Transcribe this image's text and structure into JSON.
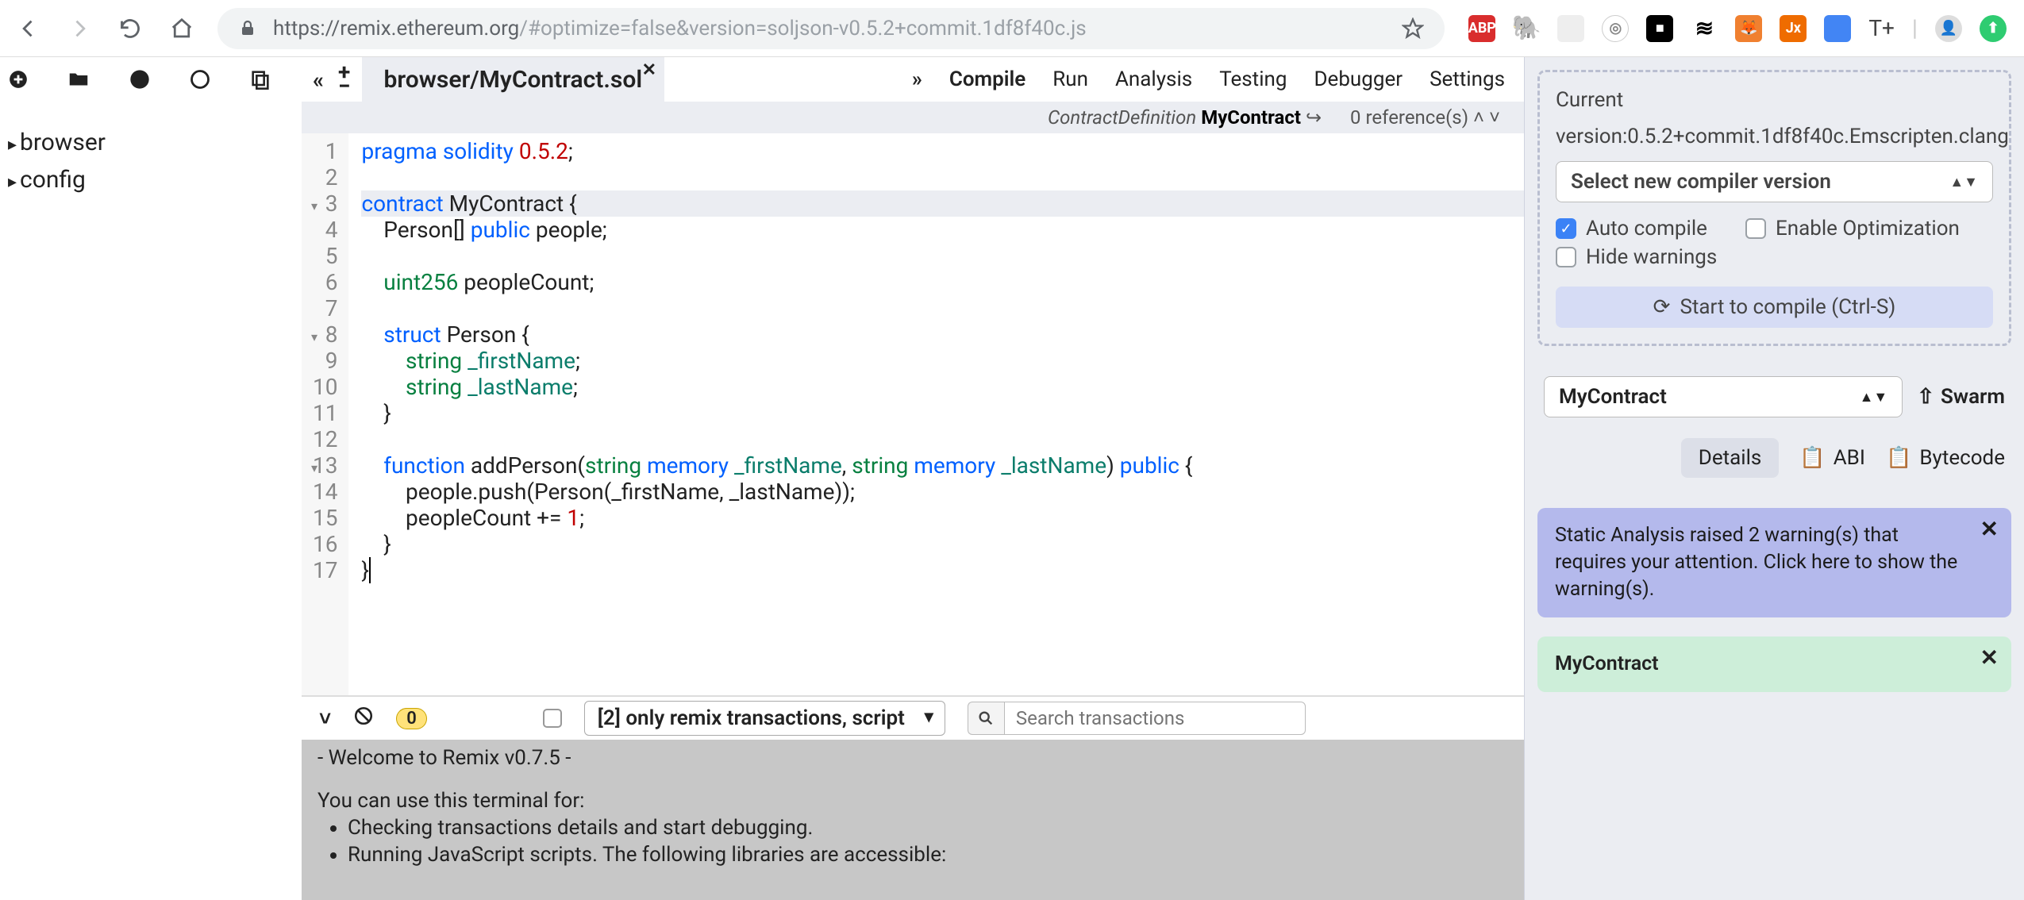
{
  "browser": {
    "url_plain": "https://remix.ethereum.org",
    "url_rest": "/#optimize=false&version=soljson-v0.5.2+commit.1df8f40c.js"
  },
  "file_tree": {
    "items": [
      "browser",
      "config"
    ]
  },
  "tab": {
    "title": "browser/MyContract.sol"
  },
  "side_tabs": [
    "Compile",
    "Run",
    "Analysis",
    "Testing",
    "Debugger",
    "Settings"
  ],
  "info_strip": {
    "cd_label": "ContractDefinition",
    "cd_name": "MyContract",
    "refs": "0 reference(s)"
  },
  "code": {
    "lines": [
      {
        "n": 1,
        "html": "<span class='kw'>pragma</span> <span class='kw'>solidity</span> <span class='num'>0.5.2</span>;"
      },
      {
        "n": 2,
        "html": ""
      },
      {
        "n": 3,
        "html": "<span class='kw'>contract</span> MyContract {",
        "fold": true,
        "hl": true
      },
      {
        "n": 4,
        "html": "    Person[] <span class='kw'>public</span> people;"
      },
      {
        "n": 5,
        "html": ""
      },
      {
        "n": 6,
        "html": "    <span class='ty'>uint256</span> peopleCount;"
      },
      {
        "n": 7,
        "html": ""
      },
      {
        "n": 8,
        "html": "    <span class='kw'>struct</span> Person {",
        "fold": true
      },
      {
        "n": 9,
        "html": "        <span class='ty'>string</span> <span class='id'>_firstName</span>;"
      },
      {
        "n": 10,
        "html": "        <span class='ty'>string</span> <span class='id'>_lastName</span>;"
      },
      {
        "n": 11,
        "html": "    }"
      },
      {
        "n": 12,
        "html": ""
      },
      {
        "n": 13,
        "html": "    <span class='kw'>function</span> addPerson(<span class='ty'>string</span> <span class='kw'>memory</span> <span class='id'>_firstName</span>, <span class='ty'>string</span> <span class='kw'>memory</span> <span class='id'>_lastName</span>) <span class='kw'>public</span> {",
        "fold": true
      },
      {
        "n": 14,
        "html": "        people.push(Person(_firstName, _lastName));"
      },
      {
        "n": 15,
        "html": "        peopleCount += <span class='num'>1</span>;"
      },
      {
        "n": 16,
        "html": "    }"
      },
      {
        "n": 17,
        "html": "}<span style='border-left:2px solid #000;'>&nbsp;</span>"
      }
    ]
  },
  "terminal": {
    "badge": "0",
    "filter": "[2] only remix transactions, script",
    "search_placeholder": "Search transactions",
    "welcome": "- Welcome to Remix v0.7.5 -",
    "intro": "You can use this terminal for:",
    "bullets": [
      "Checking transactions details and start debugging.",
      "Running JavaScript scripts. The following libraries are accessible:"
    ]
  },
  "compile_panel": {
    "current_label": "Current",
    "version": "version:0.5.2+commit.1df8f40c.Emscripten.clang",
    "select": "Select new compiler version",
    "auto": "Auto compile",
    "hide": "Hide warnings",
    "opt": "Enable Optimization",
    "button": "Start to compile (Ctrl-S)"
  },
  "contract_panel": {
    "name": "MyContract",
    "swarm": "Swarm",
    "details": "Details",
    "abi": "ABI",
    "bytecode": "Bytecode"
  },
  "alerts": {
    "warn": "Static Analysis raised 2 warning(s) that requires your attention. Click here to show the warning(s).",
    "ok": "MyContract"
  }
}
